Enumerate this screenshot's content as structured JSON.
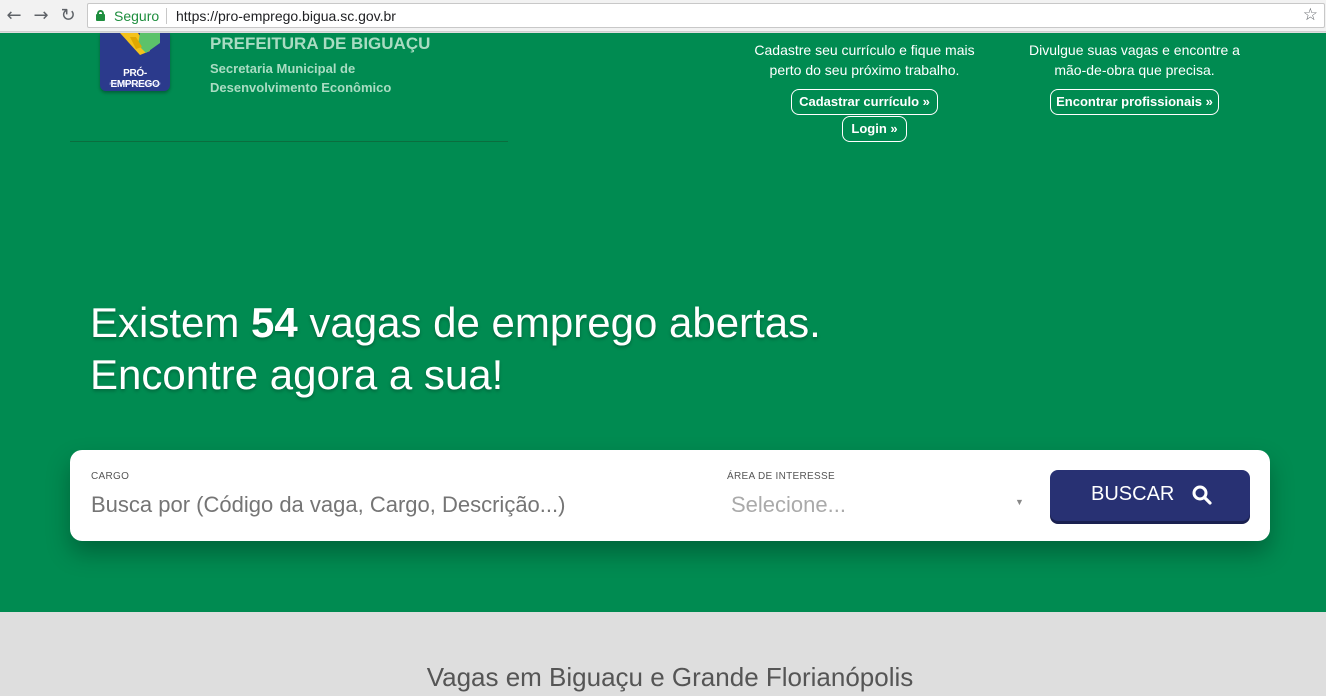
{
  "browser": {
    "secure_label": "Seguro",
    "url": "https://pro-emprego.bigua.sc.gov.br"
  },
  "header": {
    "logo_text": "PRÓ-EMPREGO",
    "logo_subtext": "PREFEITURA DE BIGUAÇU",
    "org_title": "PREFEITURA DE BIGUAÇU",
    "org_subtitle_line1": "Secretaria Municipal de",
    "org_subtitle_line2": "Desenvolvimento Econômico"
  },
  "candidate_cta": {
    "text_line1": "Cadastre seu currículo e fique mais",
    "text_line2": "perto do seu próximo trabalho.",
    "register_label": "Cadastrar currículo »",
    "login_label": "Login »"
  },
  "employer_cta": {
    "text_line1": "Divulgue suas vagas e encontre a",
    "text_line2": "mão-de-obra que precisa.",
    "find_label": "Encontrar profissionais »"
  },
  "hero": {
    "line1_prefix": "Existem ",
    "job_count": "54",
    "line1_suffix": " vagas de emprego abertas.",
    "line2": "Encontre agora a sua!"
  },
  "search": {
    "cargo_label": "CARGO",
    "cargo_placeholder": "Busca por (Código da vaga, Cargo, Descrição...)",
    "area_label": "ÁREA DE INTERESSE",
    "area_selected": "Selecione...",
    "button_label": "BUSCAR"
  },
  "section": {
    "title": "Vagas em Biguaçu e Grande Florianópolis"
  },
  "colors": {
    "hero_green": "#008b51",
    "button_navy": "#283173",
    "page_gray": "#dedede"
  },
  "icons": {
    "back": "arrow-left-icon",
    "forward": "arrow-right-icon",
    "reload": "reload-icon",
    "lock": "lock-icon",
    "bookmark": "star-icon",
    "search": "magnifier-icon"
  }
}
